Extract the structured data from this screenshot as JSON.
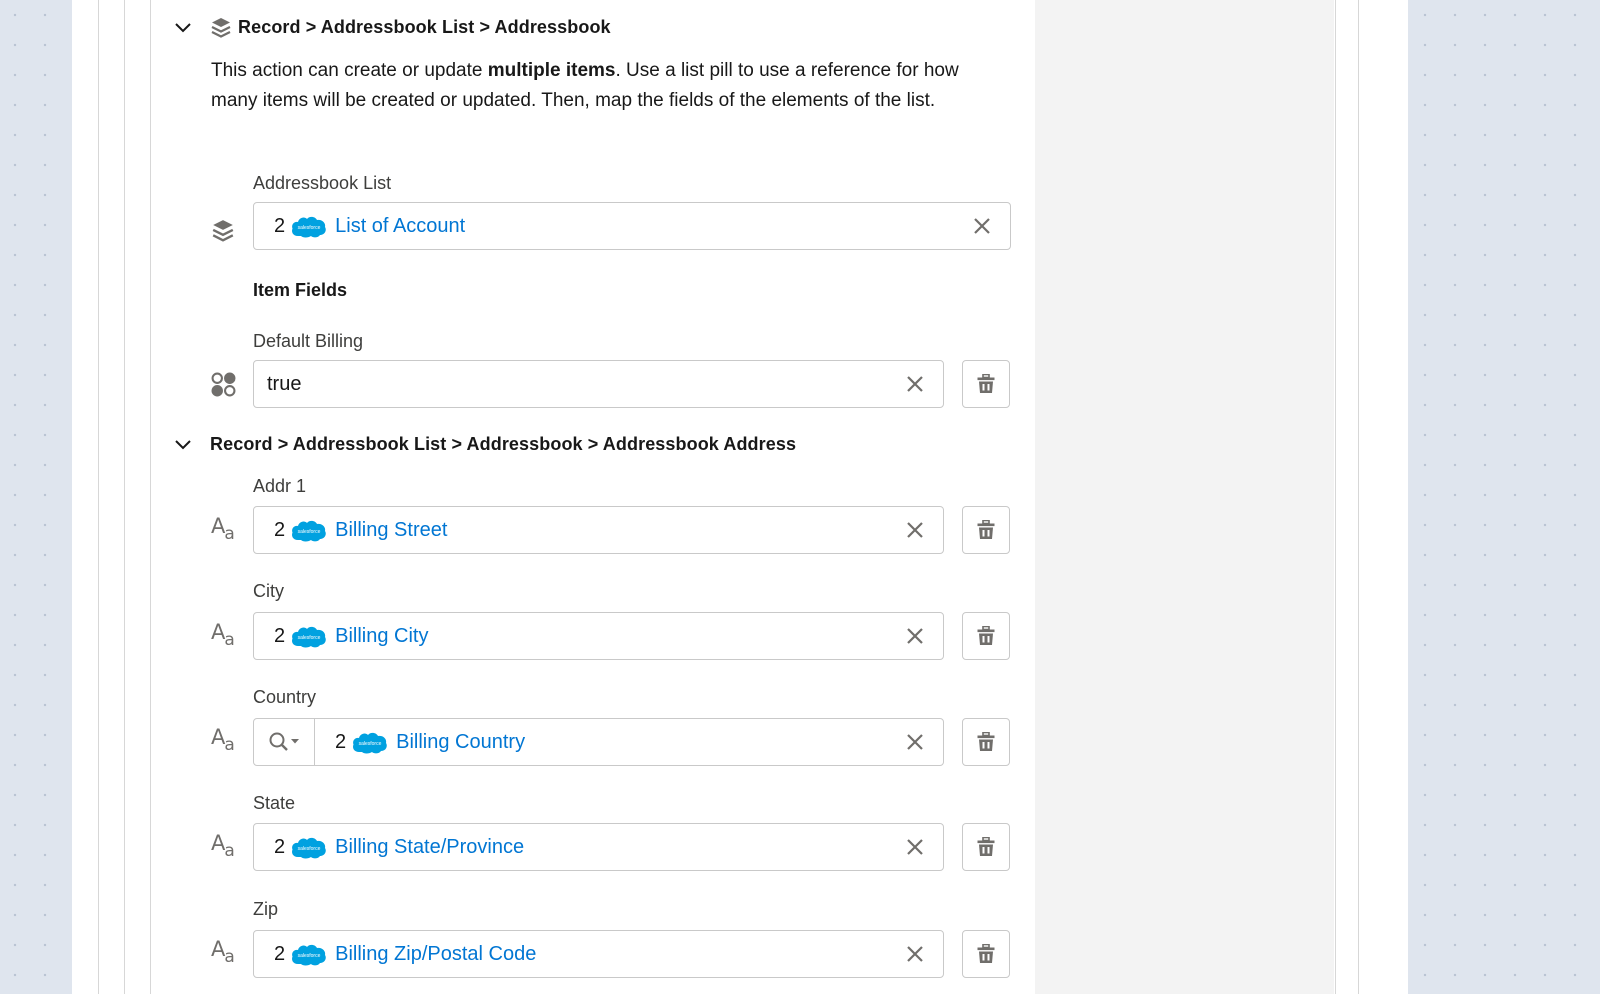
{
  "sections": {
    "addressbook": {
      "breadcrumb": "Record > Addressbook List > Addressbook",
      "description_pre": "This action can create or update ",
      "description_bold": "multiple items",
      "description_post": ". Use a list pill to use a reference for how many items will be created or updated. Then, map the fields of the elements of the list.",
      "list_field": {
        "label": "Addressbook List",
        "pill_number": "2",
        "pill_text": "List of Account"
      },
      "item_fields_heading": "Item Fields",
      "default_billing": {
        "label": "Default Billing",
        "value": "true"
      }
    },
    "address": {
      "breadcrumb": "Record > Addressbook List > Addressbook > Addressbook Address",
      "fields": [
        {
          "label": "Addr 1",
          "pill_number": "2",
          "pill_text": "Billing Street"
        },
        {
          "label": "City",
          "pill_number": "2",
          "pill_text": "Billing City"
        },
        {
          "label": "Country",
          "pill_number": "2",
          "pill_text": "Billing Country"
        },
        {
          "label": "State",
          "pill_number": "2",
          "pill_text": "Billing State/Province"
        },
        {
          "label": "Zip",
          "pill_number": "2",
          "pill_text": "Billing Zip/Postal Code"
        }
      ]
    }
  },
  "icons": {
    "type_text": "A",
    "type_text_small": "a",
    "cloud_text": "salesforce"
  },
  "colors": {
    "link": "#0176d3",
    "cloud": "#00a1e0",
    "icon": "#706e6b"
  }
}
